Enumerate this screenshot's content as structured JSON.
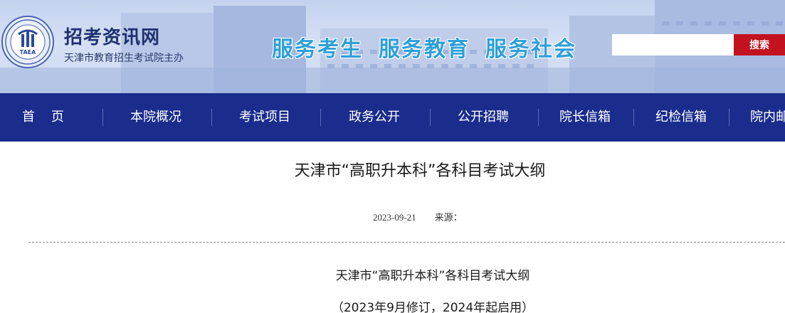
{
  "header": {
    "site_name": "招考资讯网",
    "site_subtitle": "天津市教育招生考试院主办",
    "logo_text": "TAEA",
    "slogans": [
      "服务考生",
      "服务教育",
      "服务社会"
    ],
    "search": {
      "placeholder": "",
      "value": "",
      "button_label": "搜索"
    }
  },
  "nav": {
    "items": [
      {
        "label": "首    页"
      },
      {
        "label": "本院概况"
      },
      {
        "label": "考试项目"
      },
      {
        "label": "政务公开"
      },
      {
        "label": "公开招聘"
      },
      {
        "label": "院长信箱"
      },
      {
        "label": "纪检信箱"
      },
      {
        "label": "院内邮箱"
      }
    ]
  },
  "article": {
    "title": "天津市“高职升本科”各科目考试大纲",
    "date": "2023-09-21",
    "source_label": "来源：",
    "body_title": "天津市“高职升本科”各科目考试大纲",
    "body_subtitle": "（2023年9月修订，2024年起启用）"
  },
  "colors": {
    "nav_bg": "#1a2c8c",
    "search_button": "#c3121f",
    "slogan": "#2e9fd8",
    "site_name": "#1e3170"
  }
}
